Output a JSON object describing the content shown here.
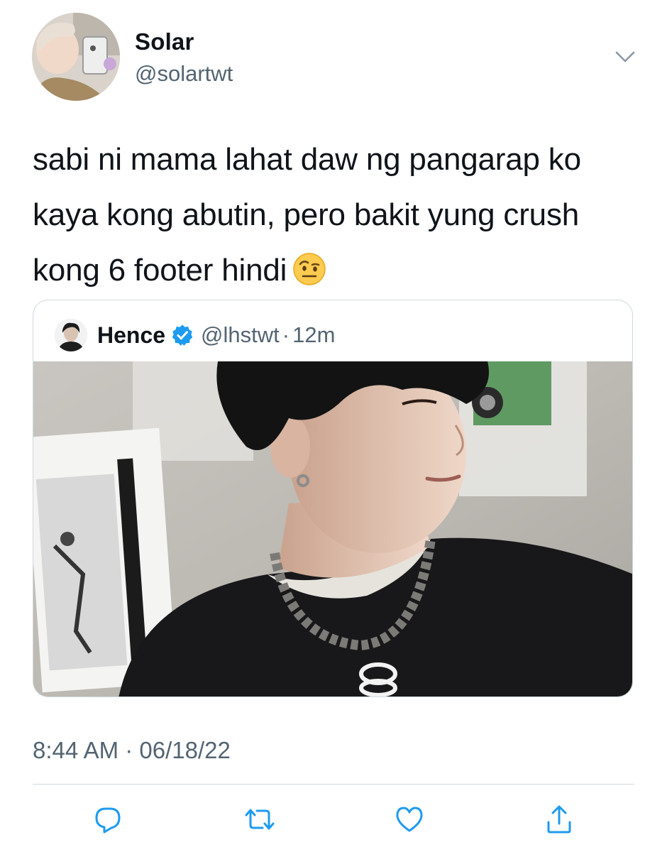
{
  "author": {
    "display_name": "Solar",
    "handle": "@solartwt"
  },
  "tweet": {
    "text": "sabi ni mama lahat daw ng pangarap ko kaya kong abutin, pero bakit yung crush kong 6 footer hindi",
    "emoji_icon": "raised-eyebrow-emoji-icon",
    "timestamp": "8:44 AM · 06/18/22"
  },
  "quoted_tweet": {
    "display_name": "Hence",
    "handle": "@lhstwt",
    "separator": "·",
    "time": "12m",
    "verified": true
  },
  "actions": {
    "reply_icon": "reply-icon",
    "retweet_icon": "retweet-icon",
    "like_icon": "heart-icon",
    "share_icon": "share-icon"
  },
  "colors": {
    "text_primary": "#0f1419",
    "text_secondary": "#536471",
    "border": "#cfd9de",
    "verified_blue": "#1d9bf0"
  }
}
